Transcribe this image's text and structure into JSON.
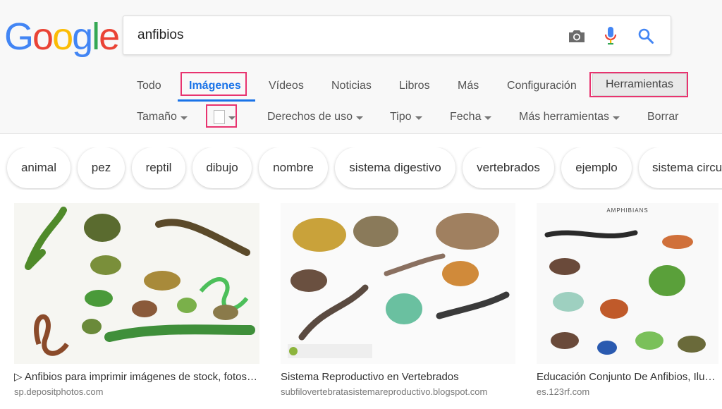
{
  "logo": {
    "letters": [
      "G",
      "o",
      "o",
      "g",
      "l",
      "e"
    ],
    "colors": [
      "#4285F4",
      "#EA4335",
      "#FBBC05",
      "#4285F4",
      "#34A853",
      "#EA4335"
    ]
  },
  "search": {
    "query": "anfibios",
    "icons": [
      "camera-icon",
      "microphone-icon",
      "search-icon"
    ]
  },
  "tabs": [
    {
      "label": "Todo"
    },
    {
      "label": "Imágenes",
      "active": true
    },
    {
      "label": "Vídeos"
    },
    {
      "label": "Noticias"
    },
    {
      "label": "Libros"
    },
    {
      "label": "Más"
    },
    {
      "label": "Configuración"
    }
  ],
  "tools_label": "Herramientas",
  "filters": {
    "size": "Tamaño",
    "rights": "Derechos de uso",
    "type": "Tipo",
    "date": "Fecha",
    "more": "Más herramientas",
    "clear": "Borrar"
  },
  "chips": [
    "animal",
    "pez",
    "reptil",
    "dibujo",
    "nombre",
    "sistema digestivo",
    "vertebrados",
    "ejemplo",
    "sistema circulatorio"
  ],
  "results": [
    {
      "title": "▷ Anfibios para imprimir imágenes de stock, fotos e ilustraciones",
      "source": "sp.depositphotos.com"
    },
    {
      "title": "Sistema Reproductivo en Vertebrados",
      "source": "subfilovertebratasistemareproductivo.blogspot.com"
    },
    {
      "title": "Educación Conjunto De Anfibios, Ilustración",
      "source": "es.123rf.com",
      "image_caption": "AMPHIBIANS"
    }
  ],
  "accent": "#1a73e8",
  "highlight": "#e8336f"
}
